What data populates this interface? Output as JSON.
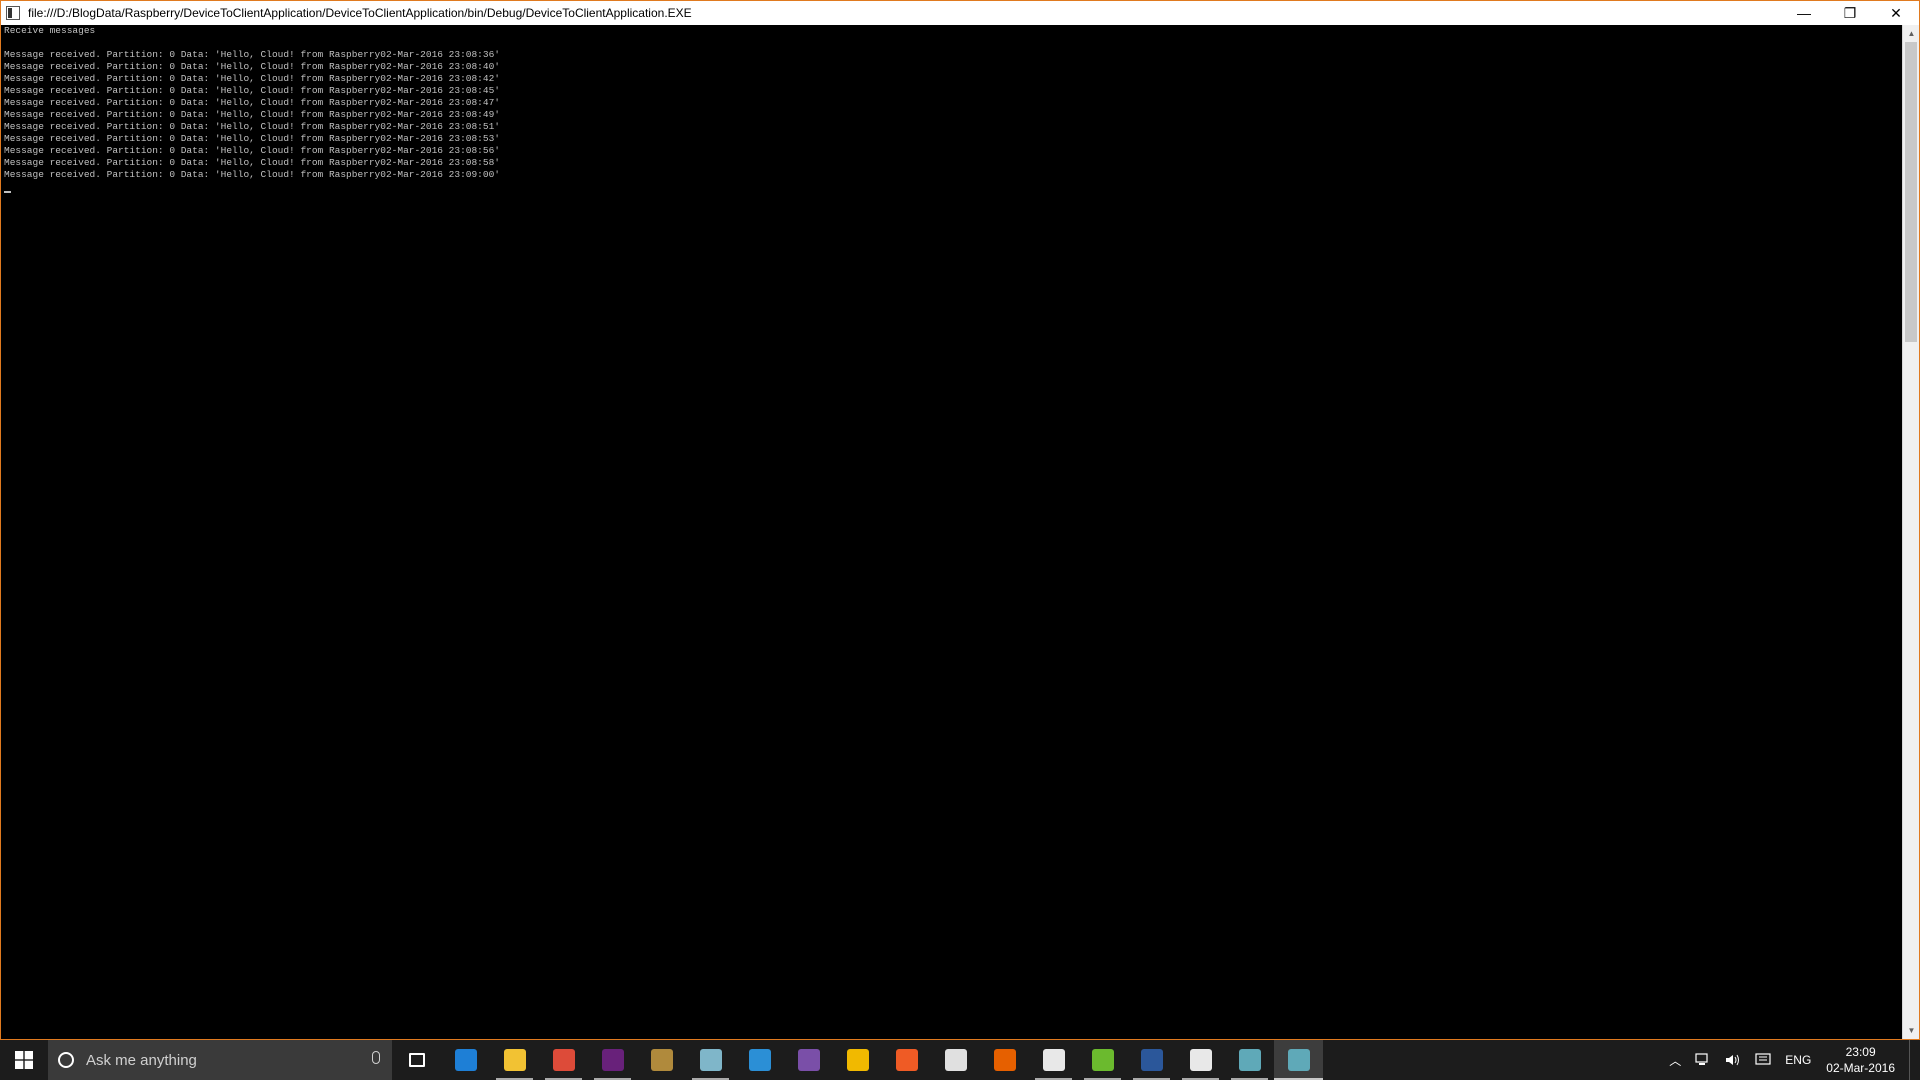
{
  "window": {
    "title": "file:///D:/BlogData/Raspberry/DeviceToClientApplication/DeviceToClientApplication/bin/Debug/DeviceToClientApplication.EXE",
    "minimize": "—",
    "restore": "❐",
    "close": "✕"
  },
  "console": {
    "header": "Receive messages",
    "lines": [
      "Message received. Partition: 0 Data: 'Hello, Cloud! from Raspberry02-Mar-2016 23:08:36'",
      "Message received. Partition: 0 Data: 'Hello, Cloud! from Raspberry02-Mar-2016 23:08:40'",
      "Message received. Partition: 0 Data: 'Hello, Cloud! from Raspberry02-Mar-2016 23:08:42'",
      "Message received. Partition: 0 Data: 'Hello, Cloud! from Raspberry02-Mar-2016 23:08:45'",
      "Message received. Partition: 0 Data: 'Hello, Cloud! from Raspberry02-Mar-2016 23:08:47'",
      "Message received. Partition: 0 Data: 'Hello, Cloud! from Raspberry02-Mar-2016 23:08:49'",
      "Message received. Partition: 0 Data: 'Hello, Cloud! from Raspberry02-Mar-2016 23:08:51'",
      "Message received. Partition: 0 Data: 'Hello, Cloud! from Raspberry02-Mar-2016 23:08:53'",
      "Message received. Partition: 0 Data: 'Hello, Cloud! from Raspberry02-Mar-2016 23:08:56'",
      "Message received. Partition: 0 Data: 'Hello, Cloud! from Raspberry02-Mar-2016 23:08:58'",
      "Message received. Partition: 0 Data: 'Hello, Cloud! from Raspberry02-Mar-2016 23:09:00'"
    ]
  },
  "taskbar": {
    "search_placeholder": "Ask me anything",
    "apps": [
      {
        "name": "task-view-icon",
        "color": "#1c1c1c",
        "running": false
      },
      {
        "name": "edge-icon",
        "color": "#1e7fd6",
        "running": false
      },
      {
        "name": "file-explorer-icon",
        "color": "#f2c233",
        "running": true
      },
      {
        "name": "chrome-icon",
        "color": "#dd4b39",
        "running": true
      },
      {
        "name": "visual-studio-icon",
        "color": "#68217a",
        "running": true
      },
      {
        "name": "tools-icon",
        "color": "#b08a3c",
        "running": false
      },
      {
        "name": "sticky-notes-icon",
        "color": "#7fb6c9",
        "running": true
      },
      {
        "name": "vscode-icon",
        "color": "#2b8fd6",
        "running": false
      },
      {
        "name": "tor-icon",
        "color": "#7a4fa8",
        "running": false
      },
      {
        "name": "app-yellow-icon",
        "color": "#f1b900",
        "running": false
      },
      {
        "name": "postman-icon",
        "color": "#ef5b25",
        "running": false
      },
      {
        "name": "app-keyboard-icon",
        "color": "#e0e0e0",
        "running": false
      },
      {
        "name": "firefox-icon",
        "color": "#e66000",
        "running": false
      },
      {
        "name": "calculator-icon",
        "color": "#e8e8e8",
        "running": true
      },
      {
        "name": "utorrent-icon",
        "color": "#6bba2e",
        "running": true
      },
      {
        "name": "word-icon",
        "color": "#2b579a",
        "running": true
      },
      {
        "name": "photos-icon",
        "color": "#e8e8e8",
        "running": true
      },
      {
        "name": "console-icon",
        "color": "#5fa9b8",
        "running": true
      },
      {
        "name": "console-active-icon",
        "color": "#5fa9b8",
        "running": true,
        "active": true
      }
    ],
    "tray": {
      "language": "ENG",
      "time": "23:09",
      "date": "02-Mar-2016"
    }
  }
}
